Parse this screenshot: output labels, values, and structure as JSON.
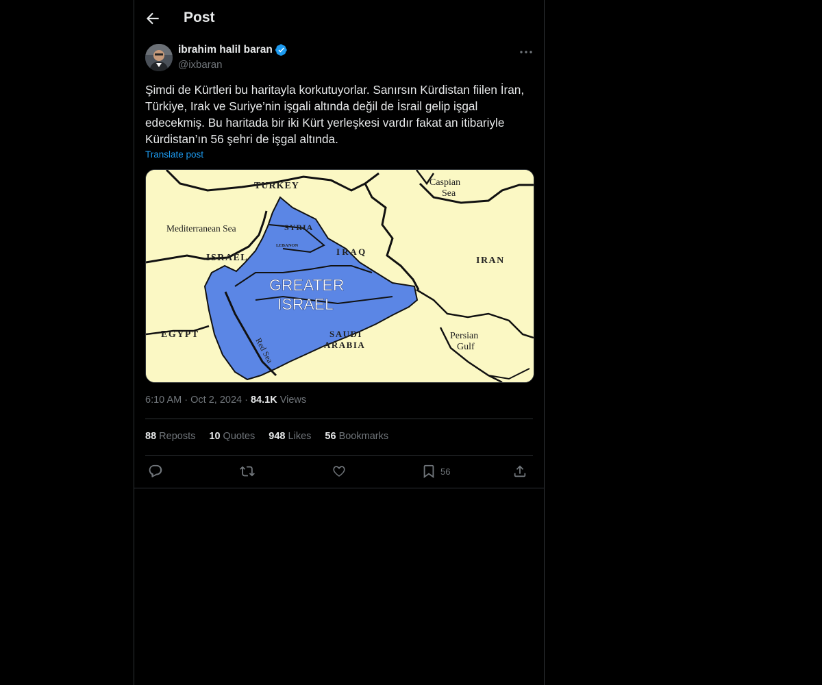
{
  "header": {
    "title": "Post",
    "back_icon": "arrow-left-icon"
  },
  "author": {
    "display_name": "ibrahim halil baran",
    "handle": "@ixbaran",
    "verified_color": "#1d9bf0"
  },
  "post": {
    "text": "Şimdi de Kürtleri bu haritayla korkutuyorlar. Sanırsın Kürdistan fiilen İran, Türkiye, Irak ve Suriye’nin işgali altında değil de İsrail gelip işgal edecekmiş. Bu haritada bir iki Kürt yerleşkesi vardır fakat an itibariyle Kürdistan’ın 56 şehri de işgal altında.",
    "translate_label": "Translate post",
    "time": "6:10 AM",
    "sep": "·",
    "date": "Oct 2, 2024",
    "views_count": "84.1K",
    "views_label": "Views"
  },
  "map": {
    "labels": {
      "turkey": "TURKEY",
      "caspian": "Caspian",
      "caspian_sea": "Sea",
      "mediterranean": "Mediterranean Sea",
      "syria": "SYRIA",
      "lebanon": "LEBANON",
      "israel": "ISRAEL",
      "iraq": "I R A Q",
      "iran": "IRAN",
      "greater": "GREATER",
      "greater_israel": "ISRAEL",
      "egypt": "EGYPT",
      "saudi": "SAUDI",
      "arabia": "ARABIA",
      "persian": "Persian",
      "gulf": "Gulf",
      "red_sea": "Red Sea"
    },
    "colors": {
      "land": "#fbf8c4",
      "highlight": "#5b86e5",
      "border": "#111111"
    }
  },
  "stats": {
    "reposts_count": "88",
    "reposts_label": "Reposts",
    "quotes_count": "10",
    "quotes_label": "Quotes",
    "likes_count": "948",
    "likes_label": "Likes",
    "bookmarks_count": "56",
    "bookmarks_label": "Bookmarks"
  },
  "actions": {
    "reply_icon": "reply-icon",
    "repost_icon": "repost-icon",
    "like_icon": "like-icon",
    "bookmark_icon": "bookmark-icon",
    "bookmark_count": "56",
    "share_icon": "share-icon"
  }
}
